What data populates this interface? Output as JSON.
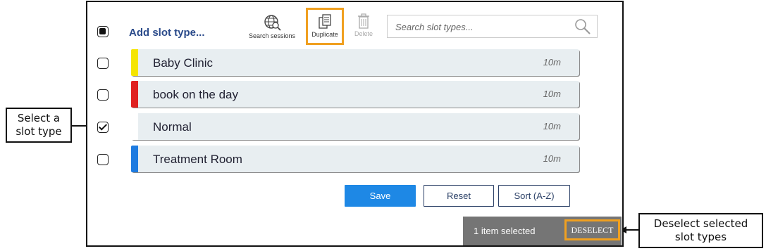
{
  "toolbar": {
    "add_slot_label": "Add slot type...",
    "search_sessions_label": "Search sessions",
    "duplicate_label": "Duplicate",
    "delete_label": "Delete",
    "search_placeholder": "Search slot types..."
  },
  "slots": [
    {
      "name": "Baby Clinic",
      "duration": "10m",
      "color": "#f5e500",
      "checked": false
    },
    {
      "name": "book on the day",
      "duration": "10m",
      "color": "#e02020",
      "checked": false
    },
    {
      "name": "Normal",
      "duration": "10m",
      "color": "#ffffff",
      "checked": true
    },
    {
      "name": "Treatment Room",
      "duration": "10m",
      "color": "#1e7be0",
      "checked": false
    }
  ],
  "actions": {
    "save_label": "Save",
    "reset_label": "Reset",
    "sort_label": "Sort (A-Z)"
  },
  "selection": {
    "count_text": "1 item selected",
    "deselect_label": "DESELECT"
  },
  "callouts": {
    "select_line1": "Select a",
    "select_line2": "slot type",
    "deselect_line1": "Deselect selected",
    "deselect_line2": "slot types"
  },
  "colors": {
    "highlight": "#f0a020",
    "primary": "#1e88e5",
    "link": "#2a4a8a"
  }
}
